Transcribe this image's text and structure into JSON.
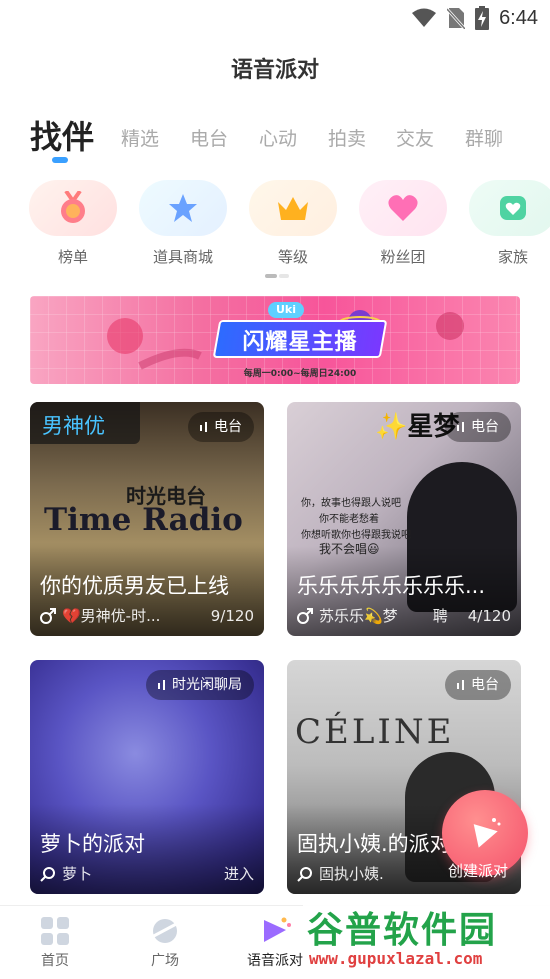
{
  "status_bar": {
    "time": "6:44"
  },
  "header": {
    "title": "语音派对"
  },
  "tabs": [
    {
      "label": "找伴",
      "active": true
    },
    {
      "label": "精选"
    },
    {
      "label": "电台"
    },
    {
      "label": "心动"
    },
    {
      "label": "拍卖"
    },
    {
      "label": "交友"
    },
    {
      "label": "群聊"
    }
  ],
  "features": [
    {
      "label": "榜单",
      "icon": "medal-icon"
    },
    {
      "label": "道具商城",
      "icon": "star-icon"
    },
    {
      "label": "等级",
      "icon": "crown-icon"
    },
    {
      "label": "粉丝团",
      "icon": "heart-icon"
    },
    {
      "label": "家族",
      "icon": "family-icon"
    }
  ],
  "banner": {
    "badge": "Uki",
    "title": "闪耀星主播",
    "subtitle": "每周一0:00~每周日24:00"
  },
  "rooms": [
    {
      "corner_label": "男神优",
      "tag": "电台",
      "title": "你的优质男友已上线",
      "host": "💔男神优-时...",
      "count": "9/120",
      "host_icon": "male-icon",
      "art_title": "Time Radio",
      "art_subtitle": "时光电台"
    },
    {
      "corner_label": "✨星梦",
      "tag": "电台",
      "title": "乐乐乐乐乐乐乐乐...",
      "host": "苏乐乐💫梦",
      "extra": "聘",
      "count": "4/120",
      "host_icon": "male-icon",
      "art_lines": [
        "你，故事也得跟人说吧",
        "你不能老愁着",
        "你想听歌你也得跟我说吧",
        "我不会唱😃"
      ]
    },
    {
      "tag": "时光闲聊局",
      "title": "萝卜的派对",
      "host": "萝卜",
      "action": "进入",
      "host_icon": "search-icon"
    },
    {
      "tag": "电台",
      "title": "固执小姨.的派对",
      "host": "固执小姨.",
      "host_icon": "search-icon",
      "art_text": "CÉLINE"
    }
  ],
  "create_party": {
    "label": "创建派对"
  },
  "bottom_nav": [
    {
      "label": "首页",
      "icon": "home-grid-icon"
    },
    {
      "label": "广场",
      "icon": "planet-icon"
    },
    {
      "label": "语音派对",
      "icon": "party-icon",
      "active": true
    }
  ],
  "watermark": {
    "title": "谷普软件园",
    "url": "www.gupuxlazal.com"
  },
  "colors": {
    "accent": "#3aa0ff",
    "fab": "#f4506a",
    "tab_inactive": "#aaaaaa"
  }
}
